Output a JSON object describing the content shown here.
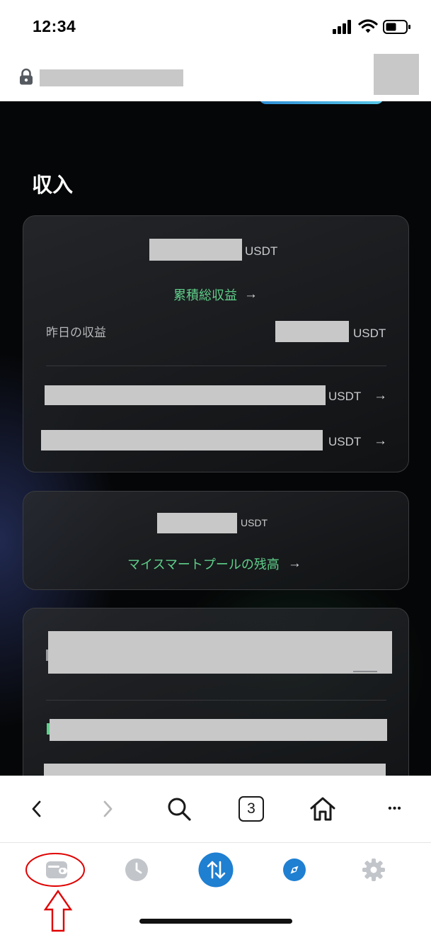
{
  "status_bar": {
    "time": "12:34"
  },
  "income": {
    "title": "収入",
    "total_card": {
      "total_unit": "USDT",
      "cumulative_link": "累積総収益",
      "cumulative_arrow": "→",
      "yesterday_label": "昨日の収益",
      "yesterday_unit": "USDT",
      "rows": [
        {
          "unit": "USDT",
          "arrow": "→"
        },
        {
          "unit": "USDT",
          "arrow": "→"
        }
      ]
    },
    "pool_card": {
      "balance_unit": "USDT",
      "pool_link": "マイスマートプールの残高",
      "pool_arrow": "→"
    }
  },
  "browser_toolbar": {
    "tabs_count": "3",
    "more_label": "•••"
  },
  "app_tabs": [
    "wallet",
    "history",
    "swap",
    "discover",
    "settings"
  ],
  "annotation": {
    "color": "#e00000"
  },
  "colors": {
    "accent_green": "#5fcf8a",
    "swap_blue": "#1f7fd1",
    "background_dark": "#050607"
  }
}
